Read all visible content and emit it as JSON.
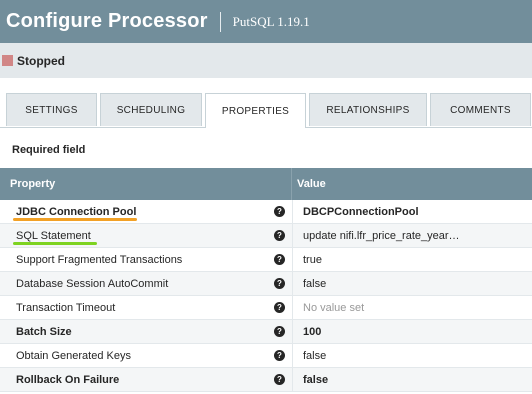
{
  "header": {
    "title": "Configure Processor",
    "subtitle": "PutSQL 1.19.1"
  },
  "status": {
    "label": "Stopped",
    "color": "#d18686"
  },
  "tabs": [
    {
      "label": "SETTINGS",
      "active": false
    },
    {
      "label": "SCHEDULING",
      "active": false
    },
    {
      "label": "PROPERTIES",
      "active": true
    },
    {
      "label": "RELATIONSHIPS",
      "active": false
    },
    {
      "label": "COMMENTS",
      "active": false
    }
  ],
  "required_label": "Required field",
  "table": {
    "headers": {
      "property": "Property",
      "value": "Value"
    },
    "rows": [
      {
        "name": "JDBC Connection Pool",
        "value": "DBCPConnectionPool",
        "required": true,
        "help_icon": "help-icon"
      },
      {
        "name": "SQL Statement",
        "value": "update nifi.lfr_price_rate_year…",
        "required": false,
        "help_icon": "help-icon"
      },
      {
        "name": "Support Fragmented Transactions",
        "value": "true",
        "required": false,
        "help_icon": "help-icon"
      },
      {
        "name": "Database Session AutoCommit",
        "value": "false",
        "required": false,
        "help_icon": "help-icon"
      },
      {
        "name": "Transaction Timeout",
        "value": "No value set",
        "required": false,
        "help_icon": "help-icon"
      },
      {
        "name": "Batch Size",
        "value": "100",
        "required": true,
        "help_icon": "help-icon"
      },
      {
        "name": "Obtain Generated Keys",
        "value": "false",
        "required": false,
        "help_icon": "help-icon"
      },
      {
        "name": "Rollback On Failure",
        "value": "false",
        "required": true,
        "help_icon": "help-icon"
      }
    ]
  },
  "colors": {
    "header_bg": "#728e9b",
    "status_bar_bg": "#e3e8eb",
    "annotation_orange": "#f2a126",
    "annotation_green": "#7ed321"
  }
}
